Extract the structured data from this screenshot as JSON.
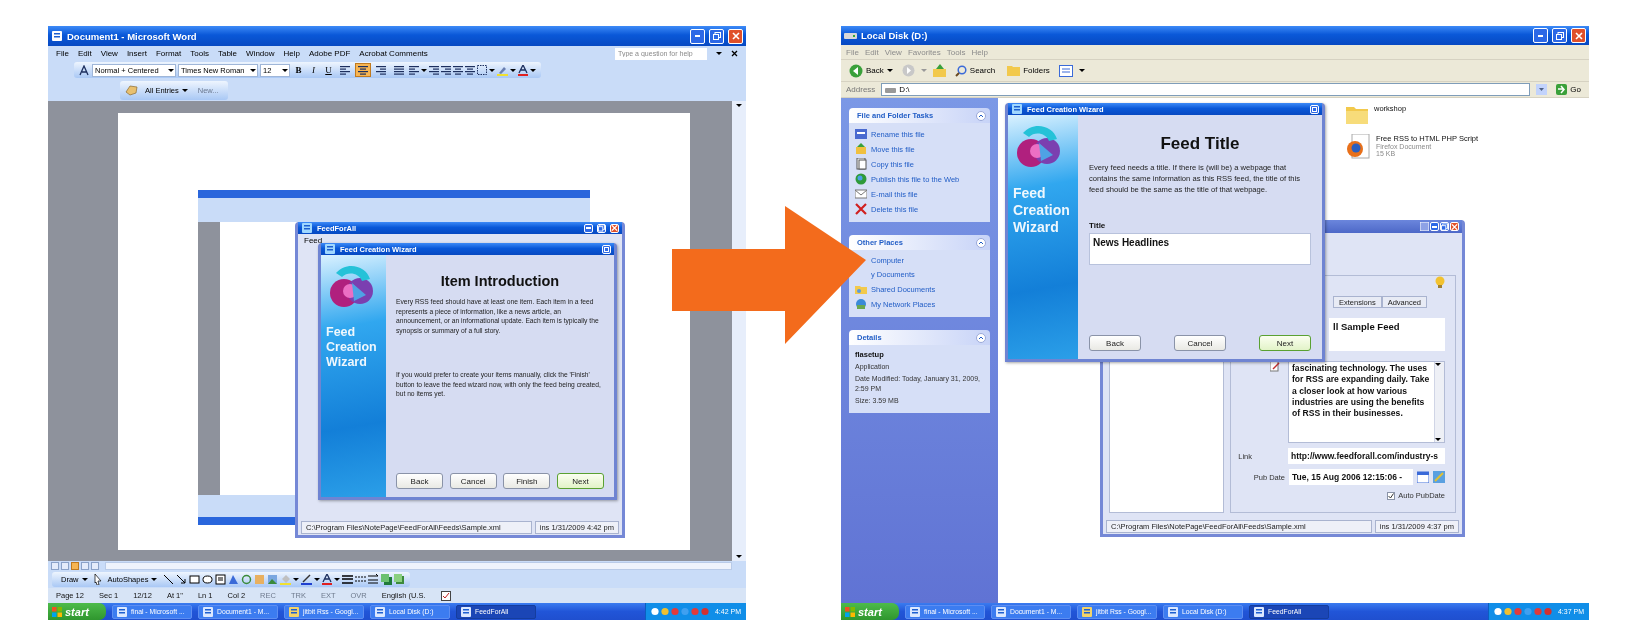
{
  "word": {
    "title": "Document1 - Microsoft Word",
    "menus": [
      "File",
      "Edit",
      "View",
      "Insert",
      "Format",
      "Tools",
      "Table",
      "Window",
      "Help",
      "Adobe PDF",
      "Acrobat Comments"
    ],
    "help_field": {
      "placeholder": "Type a question for help"
    },
    "formatting": {
      "style": "Normal + Centered",
      "font": "Times New Roman",
      "size": "12",
      "bold": "B",
      "italic": "I",
      "underline": "U",
      "align_buttons": [
        {
          "selected": false
        },
        {
          "selected": true
        },
        {
          "selected": false
        },
        {
          "selected": false
        }
      ]
    },
    "reviewing": {
      "entries": "All Entries",
      "new": {
        "label": "New...",
        "disabled": true
      }
    },
    "feedforall": {
      "title": "FeedForAll",
      "menu": "Feed",
      "status_path": "C:\\Program Files\\NotePage\\FeedForAll\\Feeds\\Sample.xml",
      "status_info": "ins 1/31/2009 4:42 pm"
    },
    "wizard": {
      "title": "Feed Creation Wizard",
      "sidebar_title": "Feed Creation Wizard",
      "heading": "Item Introduction",
      "paragraphs": [
        "Every RSS feed should have at least one item.  Each item in a feed represents a piece of information, like a news article, an announcement, or an informational update.  Each item is typically the synopsis or summary of a full story.",
        "If you would prefer to create your items manually, click the 'Finish' button to leave the feed wizard now, with only the feed being created, but no items yet."
      ],
      "buttons": [
        {
          "label": "Back",
          "default": false
        },
        {
          "label": "Cancel",
          "default": false
        },
        {
          "label": "Finish",
          "default": false
        },
        {
          "label": "Next",
          "default": true
        }
      ]
    },
    "view_buttons": [
      {
        "selected": false
      },
      {
        "selected": false
      },
      {
        "selected": true
      },
      {
        "selected": false
      },
      {
        "selected": false
      }
    ],
    "draw_toolbar": {
      "draw": "Draw",
      "autoshapes": "AutoShapes"
    },
    "status_bar": [
      {
        "text": "Page 12",
        "disabled": false
      },
      {
        "text": "Sec 1",
        "disabled": false
      },
      {
        "text": "12/12",
        "disabled": false
      },
      {
        "text": "At 1\"",
        "disabled": false
      },
      {
        "text": "Ln 1",
        "disabled": false
      },
      {
        "text": "Col 2",
        "disabled": false
      },
      {
        "text": "REC",
        "disabled": true
      },
      {
        "text": "TRK",
        "disabled": true
      },
      {
        "text": "EXT",
        "disabled": true
      },
      {
        "text": "OVR",
        "disabled": true
      },
      {
        "text": "English (U.S.",
        "disabled": false
      }
    ],
    "taskbar": {
      "start": "start",
      "items": [
        {
          "label": "final - Microsoft ...",
          "selected": false
        },
        {
          "label": "Document1 - M...",
          "selected": false
        },
        {
          "label": "jitbit Rss - Googl...",
          "selected": false
        },
        {
          "label": "Local Disk (D:)",
          "selected": false
        },
        {
          "label": "FeedForAll",
          "selected": true
        }
      ],
      "clock": "4:42 PM"
    }
  },
  "explorer": {
    "title": "Local Disk (D:)",
    "menus": [
      "File",
      "Edit",
      "View",
      "Favorites",
      "Tools",
      "Help"
    ],
    "toolbar": {
      "back": "Back",
      "search": "Search",
      "folders": "Folders"
    },
    "address": {
      "label": "Address",
      "value": "D:\\",
      "go": "Go"
    },
    "tasks": {
      "title": "File and Folder Tasks",
      "items": [
        "Rename this file",
        "Move this file",
        "Copy this file",
        "Publish this file to the Web",
        "E-mail this file",
        "Delete this file"
      ]
    },
    "places": {
      "title": "Other Places",
      "items": [
        "Computer",
        "y Documents",
        "Shared Documents",
        "My Network Places"
      ]
    },
    "details": {
      "title": "Details",
      "name": "flasetup",
      "type": "Application",
      "lines": [
        "Date Modified: Today, January 31, 2009, 2:59 PM",
        "Size: 3.59 MB"
      ]
    },
    "files": [
      {
        "name": "workshop",
        "kind": "folder"
      },
      {
        "name": "Free RSS to HTML PHP Script",
        "kind": "document",
        "type": "Firefox Document",
        "size": "15 KB"
      }
    ],
    "wizard": {
      "title": "Feed Creation Wizard",
      "sidebar_title": "Feed Creation Wizard",
      "heading": "Feed Title",
      "paragraphs": [
        "Every feed needs a title. If there is (will be) a webpage that contains the same information as this RSS feed, the title of this feed should be the same as the title of that webpage."
      ],
      "field": {
        "label": "Title",
        "value": "News Headlines"
      },
      "buttons": [
        {
          "label": "Back",
          "default": false
        },
        {
          "label": "Cancel",
          "default": false
        },
        {
          "label": "Next",
          "default": true
        }
      ]
    },
    "feedforall": {
      "tabs": [
        {
          "label": "Extensions",
          "selected": false
        },
        {
          "label": "Advanced",
          "selected": false
        }
      ],
      "title_value": "ll Sample Feed",
      "description": "fascinating technology. The uses for RSS are expanding daily. Take a closer look at how various industries are using the benefits of RSS in their businesses.",
      "link": {
        "label": "Link",
        "value": "http://www.feedforall.com/industry-s"
      },
      "pub_date": {
        "label": "Pub Date",
        "value": "Tue, 15 Aug 2006 12:15:06 -"
      },
      "auto_pubdate": {
        "label": "Auto PubDate",
        "checked": true
      },
      "status_path": "C:\\Program Files\\NotePage\\FeedForAll\\Feeds\\Sample.xml",
      "status_info": "ins 1/31/2009 4:37 pm"
    },
    "taskbar": {
      "start": "start",
      "items": [
        {
          "label": "final - Microsoft ...",
          "selected": false
        },
        {
          "label": "Document1 - M...",
          "selected": false
        },
        {
          "label": "jitbit Rss - Googl...",
          "selected": false
        },
        {
          "label": "Local Disk (D:)",
          "selected": false
        },
        {
          "label": "FeedForAll",
          "selected": true
        }
      ],
      "clock": "4:37 PM"
    }
  }
}
